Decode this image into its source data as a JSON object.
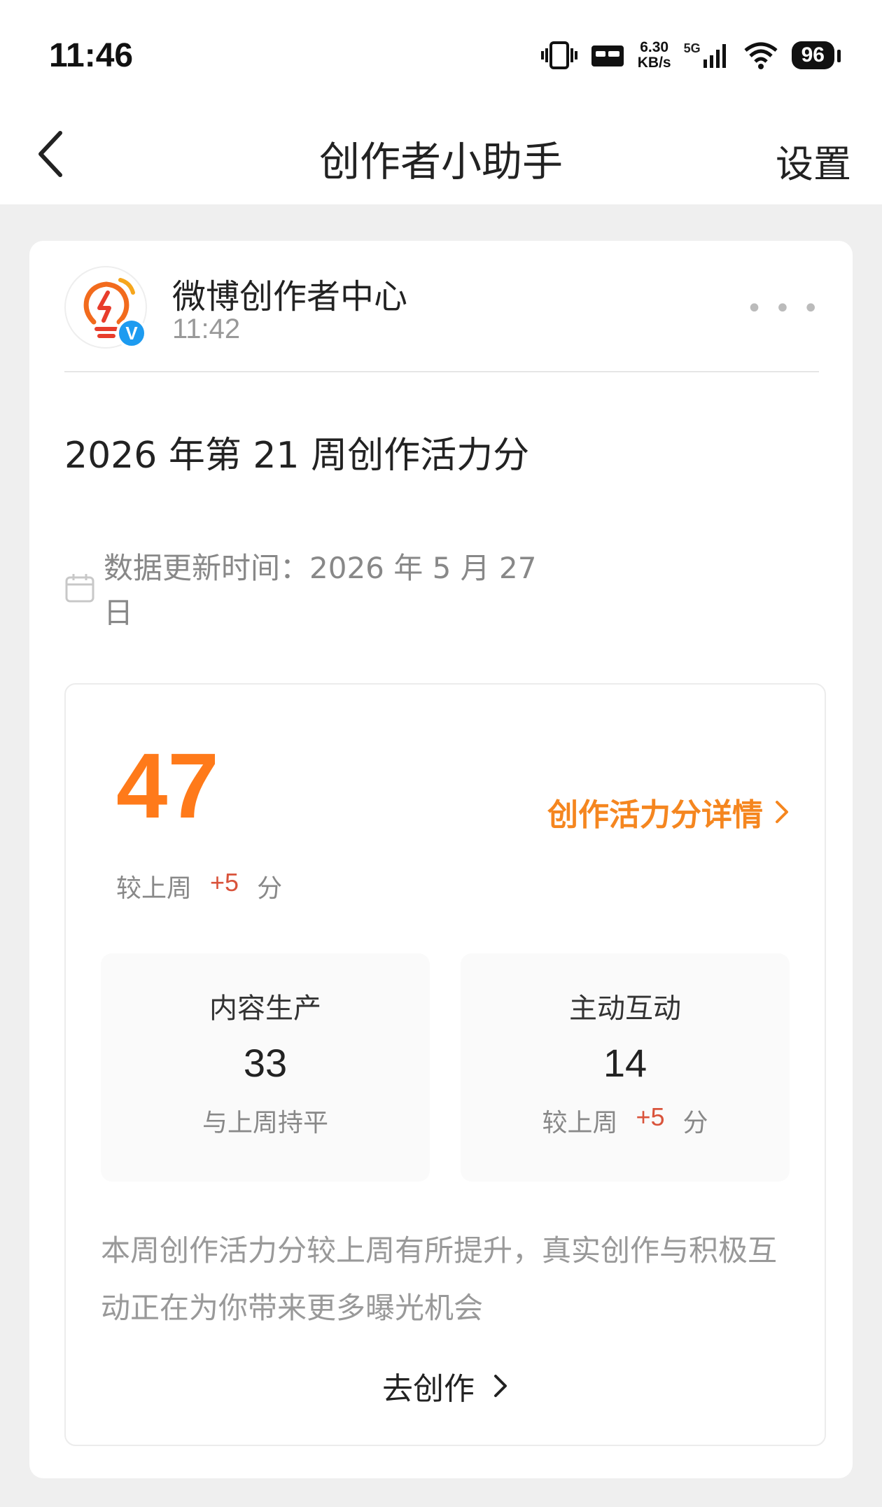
{
  "status_bar": {
    "time": "11:46",
    "net_speed_value": "6.30",
    "net_speed_unit": "KB/s",
    "network": "5G",
    "battery": "96"
  },
  "nav": {
    "title": "创作者小助手",
    "settings": "设置"
  },
  "message": {
    "sender": "微博创作者中心",
    "time": "11:42",
    "title": "2026 年第 21 周创作活力分",
    "update_time": "数据更新时间：2026 年 5 月 27 日",
    "score": "47",
    "detail_link": "创作活力分详情",
    "compare_prefix": "较上周",
    "compare_delta": "+5",
    "compare_suffix": "分",
    "content_production": {
      "title": "内容生产",
      "value": "33",
      "note": "与上周持平"
    },
    "active_interaction": {
      "title": "主动互动",
      "value": "14",
      "note_prefix": "较上周",
      "note_delta": "+5",
      "note_suffix": "分"
    },
    "summary": "本周创作活力分较上周有所提升，真实创作与积极互动正在为你带来更多曝光机会",
    "cta": "去创作"
  },
  "colors": {
    "accent_orange": "#ff7a1a",
    "delta_red": "#d9533b",
    "verify_blue": "#1d9bf0"
  }
}
